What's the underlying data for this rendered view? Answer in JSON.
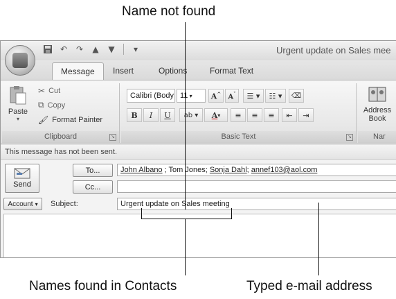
{
  "callouts": {
    "top": "Name not found",
    "bottom_left": "Names found in Contacts",
    "bottom_right": "Typed e-mail address"
  },
  "window": {
    "title": "Urgent update on Sales mee",
    "quick_access_icons": [
      "save-icon",
      "undo-icon",
      "redo-icon",
      "up-arrow-icon",
      "down-arrow-icon",
      "customize-icon"
    ]
  },
  "tabs": [
    "Message",
    "Insert",
    "Options",
    "Format Text"
  ],
  "ribbon": {
    "clipboard": {
      "paste": "Paste",
      "cut": "Cut",
      "copy": "Copy",
      "format_painter": "Format Painter",
      "label": "Clipboard"
    },
    "basic_text": {
      "font": "Calibri (Body",
      "size": "11",
      "bold": "B",
      "italic": "I",
      "underline": "U",
      "label": "Basic Text"
    },
    "names": {
      "address_book_line1": "Address",
      "address_book_line2": "Book",
      "label": "Nar"
    }
  },
  "infobar": "This message has not been sent.",
  "compose": {
    "send": "Send",
    "to_button": "To...",
    "cc_button": "Cc...",
    "recipients": {
      "john": "John Albano",
      "sep1": " ; Tom Jones; ",
      "sonja": "Sonja Dahl",
      "sep2": "; ",
      "email": "annef103@aol.com"
    },
    "account": "Account",
    "subject_label": "Subject:",
    "subject": "Urgent update on Sales meeting"
  }
}
